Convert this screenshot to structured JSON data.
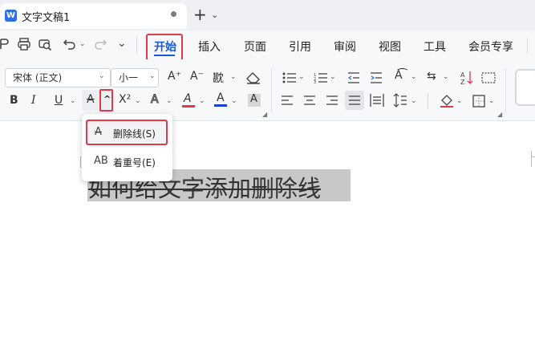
{
  "tab": {
    "title": "文字文稿1",
    "logo": "W"
  },
  "quick_access": [
    "print-icon",
    "print-preview-icon",
    "undo-icon",
    "redo-icon",
    "more-icon"
  ],
  "menu": {
    "start": "开始",
    "items": [
      "插入",
      "页面",
      "引用",
      "审阅",
      "视图",
      "工具",
      "会员专享"
    ]
  },
  "font": {
    "name": "宋体 (正文)",
    "size": "小一"
  },
  "ribbon_glyphs": {
    "grow": "A⁺",
    "shrink": "A⁻",
    "phonetic": "㽎",
    "bold": "B",
    "italic": "I",
    "underline": "U",
    "strike": "A",
    "superscript": "X²",
    "text_effect": "A",
    "highlight": "A",
    "font_color": "A",
    "char_shade": "A",
    "caret": "⌄",
    "caret_up": "^"
  },
  "dropdown": {
    "item1_label": "删除线(S)",
    "item1_icon": "A",
    "item2_label": "着重号(E)",
    "item2_icon": "AB"
  },
  "document": {
    "text": "如何给文字添加删除线"
  },
  "colors": {
    "accent": "#1a59d6",
    "highlight_box": "#e0394a",
    "font_color_bar": "#1a3fd6",
    "selection": "#c8c8c8"
  }
}
